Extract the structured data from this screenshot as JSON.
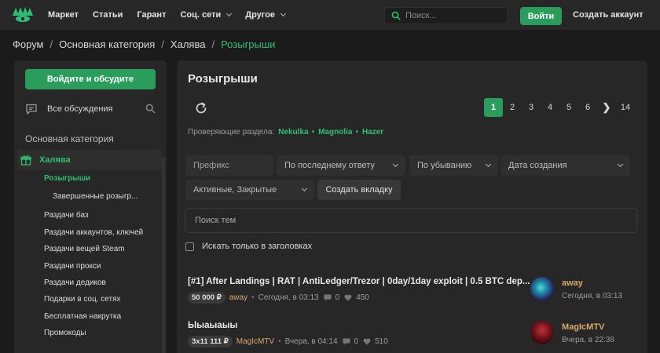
{
  "topbar": {
    "nav": [
      {
        "label": "Маркет",
        "has_dropdown": false
      },
      {
        "label": "Статьи",
        "has_dropdown": false
      },
      {
        "label": "Гарант",
        "has_dropdown": false
      },
      {
        "label": "Соц. сети",
        "has_dropdown": true
      },
      {
        "label": "Другое",
        "has_dropdown": true
      }
    ],
    "search_placeholder": "Поиск...",
    "login_label": "Войти",
    "register_label": "Создать аккаунт"
  },
  "breadcrumb": {
    "items": [
      "Форум",
      "Основная категория",
      "Халява"
    ],
    "current": "Розыгрыши",
    "separator": "/"
  },
  "sidebar": {
    "discuss_button": "Войдите и обсудите",
    "all_discussions": "Все обсуждения",
    "category_title": "Основная категория",
    "active_category": "Халява",
    "active_sub": "Розыгрыши",
    "nested_sub": "Завершенные розыгр...",
    "items": [
      "Раздачи баз",
      "Раздачи аккаунтов, ключей",
      "Раздачи вещей Steam",
      "Раздачи прокси",
      "Раздачи дедиков",
      "Подарки в соц. сетях",
      "Бесплатная накрутка",
      "Промокоды"
    ]
  },
  "main": {
    "title": "Розыгрыши",
    "pagination": {
      "current": "1",
      "pages": [
        "2",
        "3",
        "4",
        "5",
        "6"
      ],
      "last": "14",
      "next_glyph": "❯"
    },
    "reviewers_label": "Проверяющие раздела:",
    "reviewers": [
      "Nekulka",
      "Magnolia",
      "Hazer"
    ],
    "reviewer_separator": "•",
    "filters": {
      "prefix_placeholder": "Префикс",
      "sort_by": "По последнему ответу",
      "order": "По убыванию",
      "date_placeholder": "Дата создания",
      "status": "Активные, Закрытые",
      "create_tab": "Создать вкладку",
      "search_placeholder": "Поиск тем",
      "titles_only_label": "Искать только в заголовках"
    },
    "threads": [
      {
        "title": "[#1] After Landings | RAT | AntiLedger/Trezor | 0day/1day exploit | 0.5 BTC dep...",
        "price": "50 000 ₽",
        "author": "away",
        "date": "Сегодня, в 03:13",
        "replies": "0",
        "likes": "450",
        "last_user": "away",
        "last_time": "Сегодня, в 03:13"
      },
      {
        "title": "Ыыаыаыы",
        "price": "3x11 111 ₽",
        "author": "MagIcMTV",
        "date": "Вчера, в 04:14",
        "replies": "0",
        "likes": "510",
        "last_user": "MagIcMTV",
        "last_time": "Вчера, в 22:38"
      }
    ]
  },
  "colors": {
    "accent": "#2a9d5c",
    "accent_text": "#2fbf74",
    "author": "#d9a96b",
    "background": "#1b1b1b",
    "panel": "#272727"
  }
}
